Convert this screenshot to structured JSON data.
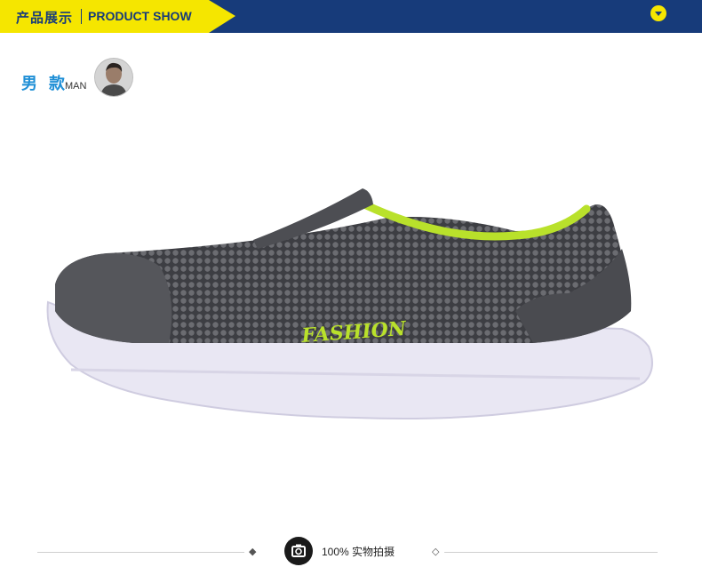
{
  "header": {
    "title_cn": "产品展示",
    "title_en": "PRODUCT SHOW",
    "toggle_icon": "chevron-down-icon",
    "colors": {
      "banner": "#173b7a",
      "accent": "#f5e600"
    }
  },
  "section": {
    "label_cn": "男 款",
    "label_en": "MAN",
    "accent": "#1f8fd6"
  },
  "product": {
    "print_text": "FASHION",
    "upper_color": "#5b5c61",
    "collar_color": "#b9e12b",
    "sole_color": "#e9e7f3"
  },
  "footer": {
    "caption": "100% 实物拍摄",
    "left_mark": "◆",
    "right_mark": "◇"
  }
}
